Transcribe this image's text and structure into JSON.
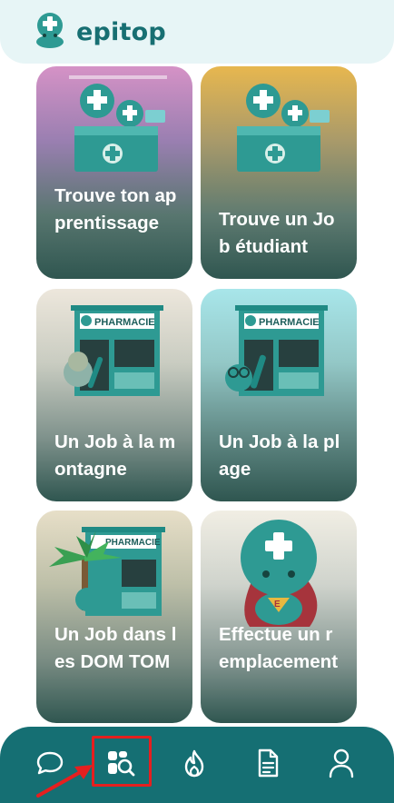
{
  "header": {
    "brand": "epitop",
    "logo_icon": "pharmacy-mascot-logo-icon"
  },
  "cards": [
    {
      "label": "Trouve ton apprentissage",
      "illustration": "mascots-with-pharmacy-box"
    },
    {
      "label": "Trouve un Job étudiant",
      "illustration": "mascots-with-pharmacy-box"
    },
    {
      "label": "Un Job à la montagne",
      "illustration": "pharmacy-storefront-mountain-mascot"
    },
    {
      "label": "Un Job à la plage",
      "illustration": "pharmacy-storefront-beach-mascot"
    },
    {
      "label": "Un Job dans les DOM TOM",
      "illustration": "pharmacy-storefront-palm-tree-mascot"
    },
    {
      "label": "Effectue un remplacement",
      "illustration": "super-mascot"
    }
  ],
  "store_sign": "PHARMACIE",
  "bottom_nav": [
    {
      "name": "chat",
      "icon": "chat-bubble-icon"
    },
    {
      "name": "job-search",
      "icon": "search-grid-icon",
      "highlighted": true
    },
    {
      "name": "trending",
      "icon": "flame-icon"
    },
    {
      "name": "documents",
      "icon": "document-icon"
    },
    {
      "name": "profile",
      "icon": "user-icon"
    }
  ],
  "colors": {
    "brand": "#176f72",
    "nav_background": "#156f73",
    "header_background": "#e7f5f6",
    "annotation_red": "#e51f1f"
  }
}
